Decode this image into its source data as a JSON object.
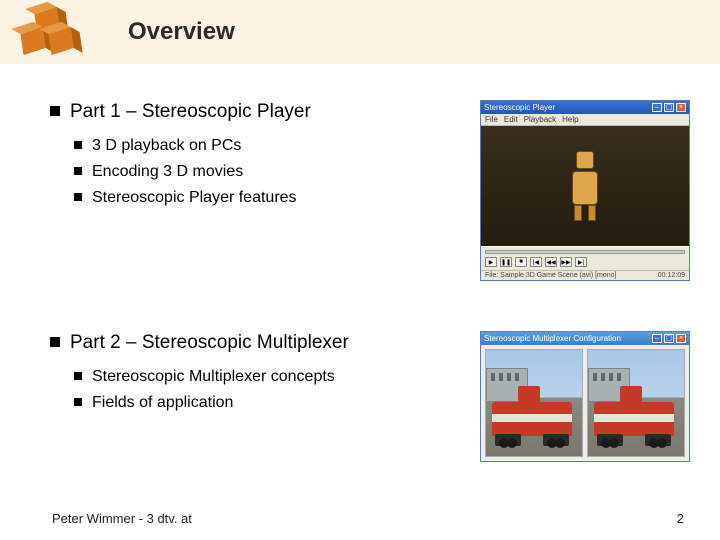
{
  "header": {
    "title": "Overview"
  },
  "sections": [
    {
      "heading": "Part 1 – Stereoscopic Player",
      "items": [
        "3 D playback on PCs",
        "Encoding 3 D movies",
        "Stereoscopic Player features"
      ]
    },
    {
      "heading": "Part 2 – Stereoscopic Multiplexer",
      "items": [
        "Stereoscopic Multiplexer concepts",
        "Fields of application"
      ]
    }
  ],
  "thumb1": {
    "title": "Stereoscopic Player",
    "menu": [
      "File",
      "Edit",
      "Playback",
      "Help"
    ],
    "status_left": "File: Sample 3D Game Scene (avi) [mono]",
    "status_right": "00:12:09"
  },
  "thumb2": {
    "title": "Stereoscopic Multiplexer Configuration"
  },
  "footer": {
    "left": "Peter Wimmer - 3 dtv. at",
    "right": "2"
  }
}
